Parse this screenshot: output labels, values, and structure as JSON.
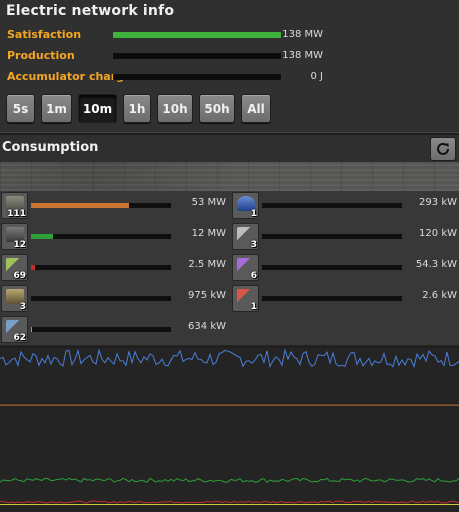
{
  "window": {
    "title": "Electric network info"
  },
  "stats": [
    {
      "label": "Satisfaction",
      "value": "138 MW",
      "fill": 1.0,
      "color": "#3db33d"
    },
    {
      "label": "Production",
      "value": "138 MW",
      "fill": 0,
      "color": "#3db33d"
    },
    {
      "label": "Accumulator charge",
      "value": "0 J",
      "fill": 0,
      "color": "#3db33d"
    }
  ],
  "time_buttons": [
    "5s",
    "1m",
    "10m",
    "1h",
    "10h",
    "50h",
    "All"
  ],
  "selected_time": "10m",
  "consumption": {
    "title": "Consumption",
    "refresh_icon": "refresh-icon"
  },
  "entities": [
    {
      "icon": "assembling-machine-icon",
      "count": "111",
      "value": "53 MW",
      "fill": 0.7,
      "color": "#c87533"
    },
    {
      "icon": "lab-icon",
      "count": "1",
      "value": "293 kW",
      "fill": 0,
      "color": "#3d6fcf"
    },
    {
      "icon": "electric-furnace-icon",
      "count": "12",
      "value": "12 MW",
      "fill": 0.16,
      "color": "#2fa03a"
    },
    {
      "icon": "inserter-icon",
      "count": "3",
      "value": "120 kW",
      "fill": 0,
      "color": "#9a9a9a"
    },
    {
      "icon": "fast-inserter-icon",
      "count": "69",
      "value": "2.5 MW",
      "fill": 0.03,
      "color": "#c0302b"
    },
    {
      "icon": "stack-inserter-icon",
      "count": "6",
      "value": "54.3 kW",
      "fill": 0,
      "color": "#8a4bc8"
    },
    {
      "icon": "mining-drill-icon",
      "count": "3",
      "value": "975 kW",
      "fill": 0,
      "color": "#a58a4a"
    },
    {
      "icon": "filter-inserter-icon",
      "count": "1",
      "value": "2.6 kW",
      "fill": 0,
      "color": "#c0302b"
    },
    {
      "icon": "long-inserter-icon",
      "count": "62",
      "value": "634 kW",
      "fill": 0.01,
      "color": "#9a9a6a"
    }
  ],
  "graph_series": [
    {
      "color": "#4a7fd8",
      "level": 0.92,
      "noise": 0.05
    },
    {
      "color": "#c87533",
      "level": 0.64,
      "noise": 0.0
    },
    {
      "color": "#2fa03a",
      "level": 0.19,
      "noise": 0.012
    },
    {
      "color": "#c0302b",
      "level": 0.06,
      "noise": 0.006
    },
    {
      "color": "#c9c93a",
      "level": 0.045,
      "noise": 0.0
    }
  ]
}
